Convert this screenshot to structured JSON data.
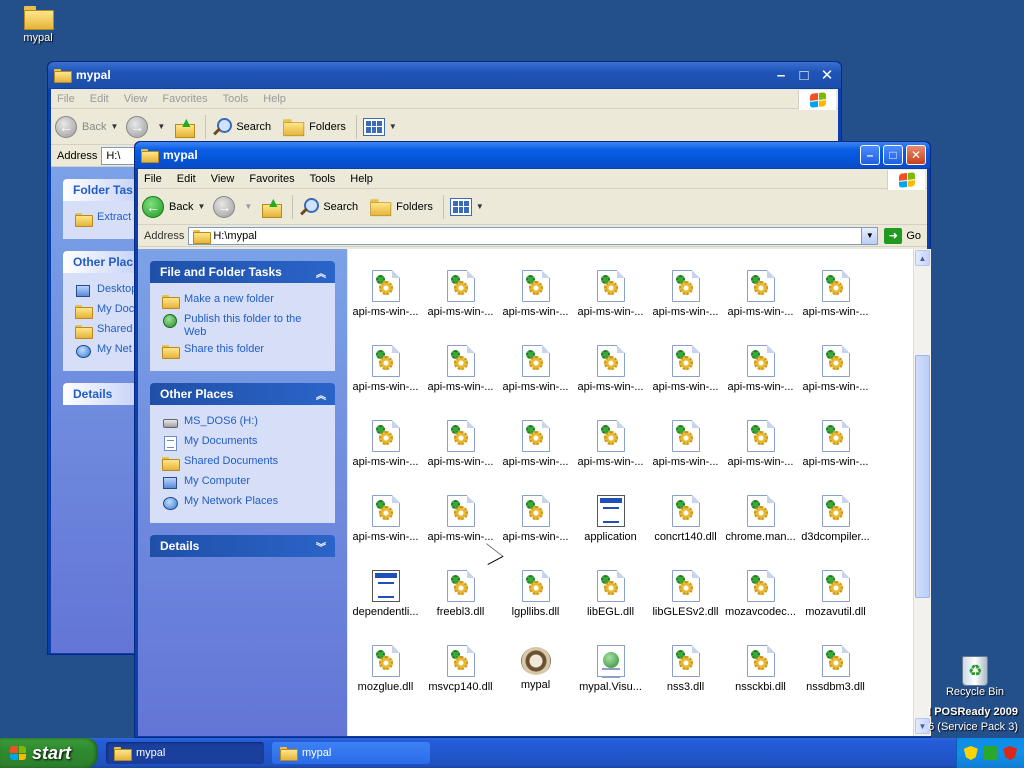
{
  "desktop": {
    "top_icon_label": "mypal",
    "recycle_bin_label": "Recycle Bin",
    "watermark_line1": "l POSReady 2009",
    "watermark_line2": "6 (Service Pack 3)"
  },
  "back_window": {
    "title": "mypal",
    "menu": [
      "File",
      "Edit",
      "View",
      "Favorites",
      "Tools",
      "Help"
    ],
    "toolbar": {
      "back": "Back",
      "search": "Search",
      "folders": "Folders"
    },
    "address_label": "Address",
    "address_value": "H:\\",
    "panels": [
      {
        "title": "Folder Tas",
        "items": [
          "Extract"
        ]
      },
      {
        "title": "Other Plac",
        "items": [
          "Desktop",
          "My Doc",
          "Shared",
          "My Net"
        ]
      },
      {
        "title": "Details",
        "items": []
      }
    ]
  },
  "front_window": {
    "title": "mypal",
    "menu": [
      "File",
      "Edit",
      "View",
      "Favorites",
      "Tools",
      "Help"
    ],
    "toolbar": {
      "back": "Back",
      "search": "Search",
      "folders": "Folders"
    },
    "address_label": "Address",
    "address_value": "H:\\mypal",
    "go_label": "Go",
    "file_tasks": {
      "title": "File and Folder Tasks",
      "items": [
        "Make a new folder",
        "Publish this folder to the Web",
        "Share this folder"
      ]
    },
    "other_places": {
      "title": "Other Places",
      "items": [
        "MS_DOS6 (H:)",
        "My Documents",
        "Shared Documents",
        "My Computer",
        "My Network Places"
      ]
    },
    "details": {
      "title": "Details"
    },
    "files": [
      [
        "api-ms-win-...",
        "api-ms-win-...",
        "api-ms-win-...",
        "api-ms-win-...",
        "api-ms-win-...",
        "api-ms-win-...",
        "api-ms-win-..."
      ],
      [
        "api-ms-win-...",
        "api-ms-win-...",
        "api-ms-win-...",
        "api-ms-win-...",
        "api-ms-win-...",
        "api-ms-win-...",
        "api-ms-win-..."
      ],
      [
        "api-ms-win-...",
        "api-ms-win-...",
        "api-ms-win-...",
        "api-ms-win-...",
        "api-ms-win-...",
        "api-ms-win-...",
        "api-ms-win-..."
      ],
      [
        "api-ms-win-...",
        "api-ms-win-...",
        "api-ms-win-...",
        "api-ms-win-...",
        "api-ms-win-...",
        "api-ms-win-...",
        "api-ms-win-..."
      ],
      [
        "api-ms-win-...",
        "api-ms-win-...",
        "api-ms-win-...",
        "application",
        "concrt140.dll",
        "chrome.man...",
        "d3dcompiler..."
      ],
      [
        "dependentli...",
        "freebl3.dll",
        "lgpllibs.dll",
        "libEGL.dll",
        "libGLESv2.dll",
        "mozavcodec...",
        "mozavutil.dll"
      ],
      [
        "mozglue.dll",
        "msvcp140.dll",
        "mypal",
        "mypal.Visu...",
        "nss3.dll",
        "nssckbi.dll",
        "nssdbm3.dll"
      ]
    ],
    "file_icon_types": [
      [
        "dll",
        "dll",
        "dll",
        "dll",
        "dll",
        "dll",
        "dll"
      ],
      [
        "dll",
        "dll",
        "dll",
        "dll",
        "dll",
        "dll",
        "dll"
      ],
      [
        "dll",
        "dll",
        "dll",
        "dll",
        "dll",
        "dll",
        "dll"
      ],
      [
        "dll",
        "dll",
        "dll",
        "dll",
        "dll",
        "dll",
        "dll"
      ],
      [
        "dll",
        "dll",
        "dll",
        "app",
        "dll",
        "dll",
        "dll"
      ],
      [
        "app",
        "dll",
        "dll",
        "dll",
        "dll",
        "dll",
        "dll"
      ],
      [
        "dll",
        "dll",
        "raccoon",
        "xml",
        "dll",
        "dll",
        "dll"
      ]
    ]
  },
  "taskbar": {
    "start_label": "start",
    "tasks": [
      "mypal",
      "mypal"
    ]
  }
}
